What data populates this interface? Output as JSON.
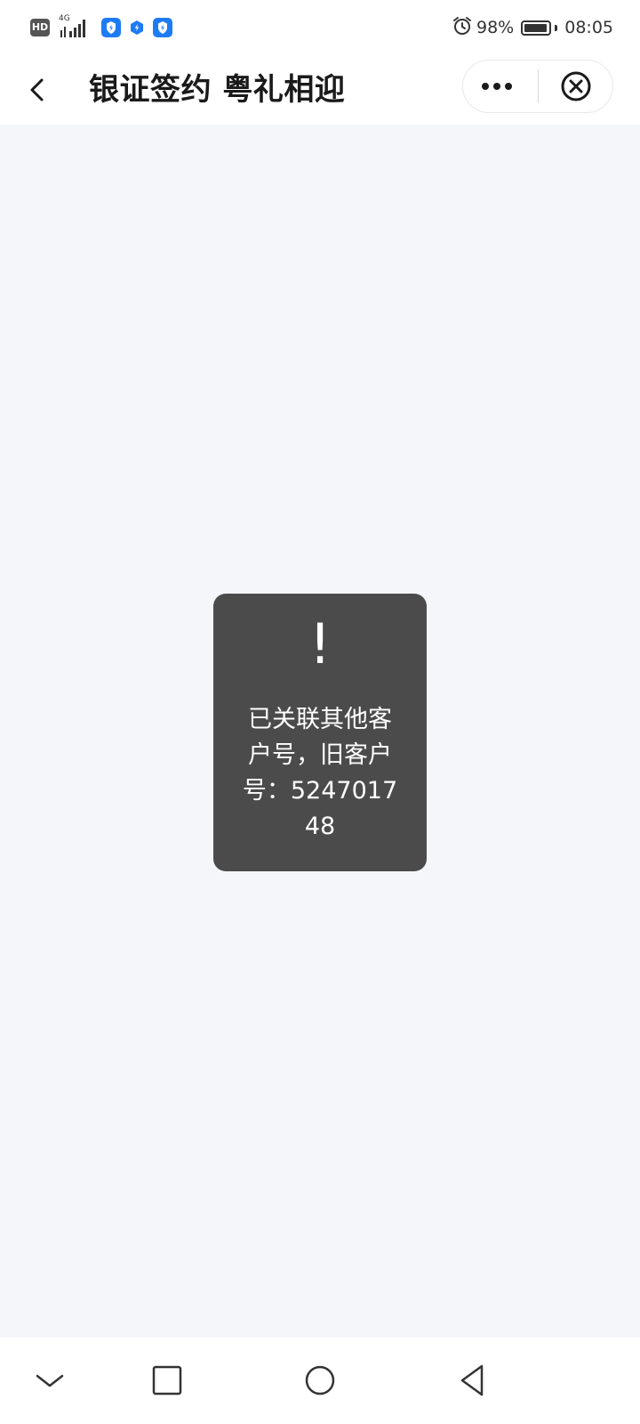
{
  "status_bar": {
    "hd_label": "HD",
    "network_label": "4G",
    "battery_percent": "98%",
    "battery_level": 0.98,
    "time": "08:05",
    "app_badge_color": "#1e7bf6"
  },
  "title_bar": {
    "title": "银证签约 粤礼相迎",
    "back_icon": "chevron-left-icon",
    "more_icon": "more-dots-icon",
    "close_icon": "circle-x-icon"
  },
  "toast": {
    "icon_text": "!",
    "message": "已关联其他客户号，旧客户号：524701748",
    "background": "#4b4b4b"
  },
  "nav_bar": {
    "icons": [
      "chevron-down-icon",
      "square-icon",
      "circle-icon",
      "triangle-back-icon"
    ]
  },
  "colors": {
    "page_background": "#f4f6fa",
    "bar_background": "#ffffff",
    "accent": "#1e7bf6"
  }
}
